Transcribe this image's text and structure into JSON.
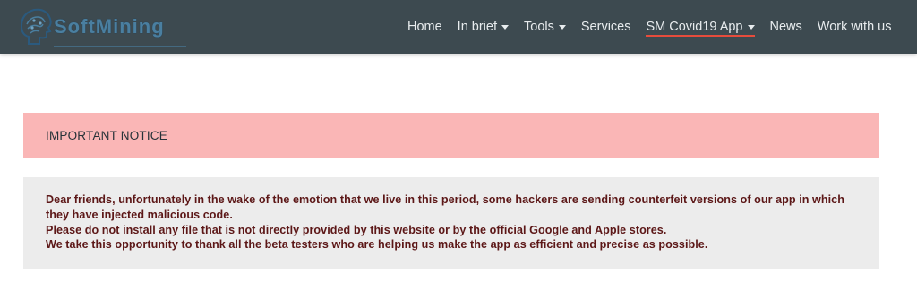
{
  "brand": {
    "name_part1": "Soft",
    "name_part2": "Mining",
    "accent_color": "#4a7fa0"
  },
  "nav": {
    "items": [
      {
        "label": "Home",
        "dropdown": false
      },
      {
        "label": "In brief",
        "dropdown": true
      },
      {
        "label": "Tools",
        "dropdown": true
      },
      {
        "label": "Services",
        "dropdown": false
      },
      {
        "label": "SM Covid19 App",
        "dropdown": true,
        "active": true
      },
      {
        "label": "News",
        "dropdown": false
      },
      {
        "label": "Work with us",
        "dropdown": false
      }
    ],
    "background": "#3d4a50",
    "active_underline_color": "#e74c3c"
  },
  "notice": {
    "title": "IMPORTANT NOTICE",
    "title_background": "#fab6b6",
    "body_background": "#ececec",
    "text_color": "#5c1717",
    "lines": [
      "Dear friends, unfortunately in the wake of the emotion that we live in this period, some hackers are sending counterfeit versions of our app in which they have injected malicious code.",
      "Please do not install any file that is not directly provided by this website or by the official Google and Apple stores.",
      "We take this opportunity to thank all the beta testers who are helping us make the app as efficient and precise as possible."
    ]
  }
}
